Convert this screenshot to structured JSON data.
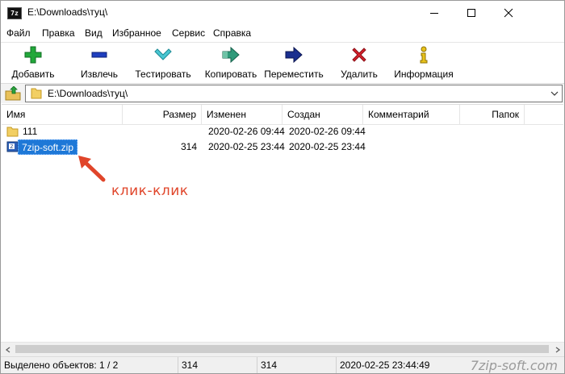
{
  "window": {
    "title": "E:\\Downloads\\туц\\",
    "app_icon_text": "7z"
  },
  "menu": [
    {
      "label": "Файл"
    },
    {
      "label": "Правка"
    },
    {
      "label": "Вид"
    },
    {
      "label": "Избранное"
    },
    {
      "label": "Сервис"
    },
    {
      "label": "Справка"
    }
  ],
  "toolbar": {
    "add": "Добавить",
    "extract": "Извлечь",
    "test": "Тестировать",
    "copy": "Копировать",
    "move": "Переместить",
    "delete": "Удалить",
    "info": "Информация"
  },
  "address": {
    "path": "E:\\Downloads\\туц\\"
  },
  "columns": {
    "name": "Имя",
    "size": "Размер",
    "modified": "Изменен",
    "created": "Создан",
    "comment": "Комментарий",
    "folders": "Папок"
  },
  "rows": [
    {
      "name": "111",
      "size": "",
      "modified": "2020-02-26 09:44",
      "created": "2020-02-26 09:44",
      "type": "folder"
    },
    {
      "name": "7zip-soft.zip",
      "size": "314",
      "modified": "2020-02-25 23:44",
      "created": "2020-02-25 23:44",
      "type": "archive",
      "selected": true
    }
  ],
  "annotation": {
    "text": "клик-клик",
    "color": "#e0452a"
  },
  "status": {
    "selected": "Выделено объектов: 1 / 2",
    "size": "314",
    "packed": "314",
    "date": "2020-02-25 23:44:49"
  },
  "watermark": "7zip-soft.com",
  "colors": {
    "selection": "#1e78d7",
    "add_green": "#22a83a",
    "extract_blue": "#1f3fbf",
    "test_teal": "#49c6d2",
    "delete_red": "#d9212c",
    "info_yellow": "#e8c21a"
  }
}
